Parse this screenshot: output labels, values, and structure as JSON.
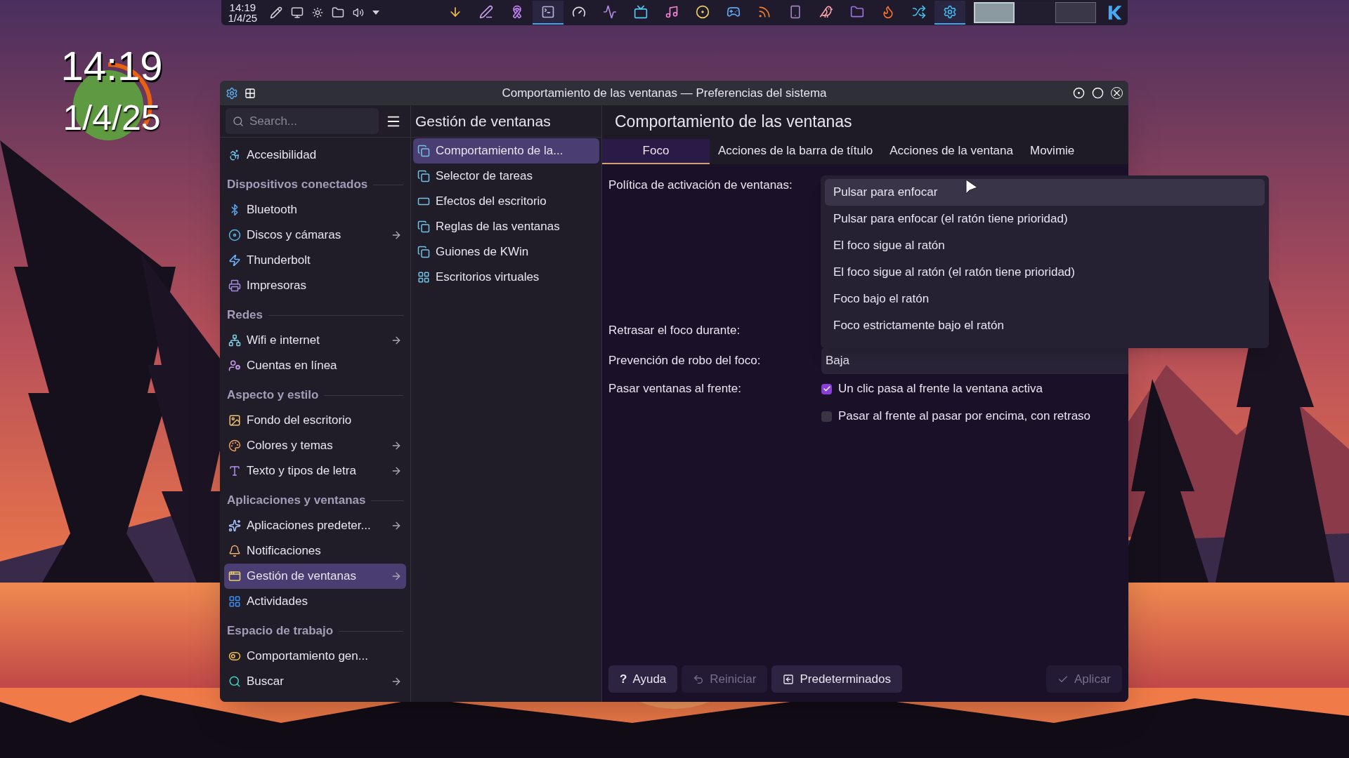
{
  "desktop_clock": {
    "time": "14:19",
    "date": "1/4/25"
  },
  "panel": {
    "clock": {
      "time": "14:19",
      "date": "1/4/25"
    },
    "tasks": [
      {
        "active": false
      },
      {
        "active": false
      },
      {
        "active": false
      },
      {
        "active": true
      },
      {
        "active": false
      },
      {
        "active": false
      },
      {
        "active": false
      },
      {
        "active": false
      },
      {
        "active": false
      },
      {
        "active": false
      },
      {
        "active": false
      },
      {
        "active": false
      },
      {
        "active": false
      },
      {
        "active": false
      },
      {
        "active": false
      },
      {
        "active": false
      },
      {
        "active": true
      }
    ],
    "pager": [
      {
        "selected": true
      },
      {
        "selected": false
      },
      {
        "selected": false
      }
    ]
  },
  "window": {
    "title": "Comportamiento de las ventanas — Preferencias del sistema"
  },
  "sidebar": {
    "search": {
      "placeholder": "Search..."
    },
    "items": [
      {
        "kind": "item",
        "label": "Accesibilidad",
        "arrow": false,
        "selected": false
      },
      {
        "kind": "heading",
        "label": "Dispositivos conectados"
      },
      {
        "kind": "item",
        "label": "Bluetooth",
        "arrow": false,
        "selected": false
      },
      {
        "kind": "item",
        "label": "Discos y cámaras",
        "arrow": true,
        "selected": false
      },
      {
        "kind": "item",
        "label": "Thunderbolt",
        "arrow": false,
        "selected": false
      },
      {
        "kind": "item",
        "label": "Impresoras",
        "arrow": false,
        "selected": false
      },
      {
        "kind": "heading",
        "label": "Redes"
      },
      {
        "kind": "item",
        "label": "Wifi e internet",
        "arrow": true,
        "selected": false
      },
      {
        "kind": "item",
        "label": "Cuentas en línea",
        "arrow": false,
        "selected": false
      },
      {
        "kind": "heading",
        "label": "Aspecto y estilo"
      },
      {
        "kind": "item",
        "label": "Fondo del escritorio",
        "arrow": false,
        "selected": false
      },
      {
        "kind": "item",
        "label": "Colores y temas",
        "arrow": true,
        "selected": false
      },
      {
        "kind": "item",
        "label": "Texto y tipos de letra",
        "arrow": true,
        "selected": false
      },
      {
        "kind": "heading",
        "label": "Aplicaciones y ventanas"
      },
      {
        "kind": "item",
        "label": "Aplicaciones predeter...",
        "arrow": true,
        "selected": false
      },
      {
        "kind": "item",
        "label": "Notificaciones",
        "arrow": false,
        "selected": false
      },
      {
        "kind": "item",
        "label": "Gestión de ventanas",
        "arrow": true,
        "selected": true
      },
      {
        "kind": "item",
        "label": "Actividades",
        "arrow": false,
        "selected": false
      },
      {
        "kind": "heading",
        "label": "Espacio de trabajo"
      },
      {
        "kind": "item",
        "label": "Comportamiento gen...",
        "arrow": false,
        "selected": false
      },
      {
        "kind": "item",
        "label": "Buscar",
        "arrow": true,
        "selected": false
      }
    ]
  },
  "subpages": {
    "title": "Gestión de ventanas",
    "items": [
      {
        "label": "Comportamiento de la...",
        "selected": true
      },
      {
        "label": "Selector de tareas",
        "selected": false
      },
      {
        "label": "Efectos del escritorio",
        "selected": false
      },
      {
        "label": "Reglas de las ventanas",
        "selected": false
      },
      {
        "label": "Guiones de KWin",
        "selected": false
      },
      {
        "label": "Escritorios virtuales",
        "selected": false
      }
    ]
  },
  "content": {
    "title": "Comportamiento de las ventanas",
    "tabs": [
      {
        "label": "Foco",
        "selected": true
      },
      {
        "label": "Acciones de la barra de título",
        "selected": false
      },
      {
        "label": "Acciones de la ventana",
        "selected": false
      },
      {
        "label": "Movimie",
        "selected": false
      }
    ],
    "activation_policy": {
      "label": "Política de activación de ventanas:",
      "options": [
        {
          "label": "Pulsar para enfocar",
          "selected": true
        },
        {
          "label": "Pulsar para enfocar (el ratón tiene prioridad)",
          "selected": false
        },
        {
          "label": "El foco sigue al ratón",
          "selected": false
        },
        {
          "label": "El foco sigue al ratón (el ratón tiene prioridad)",
          "selected": false
        },
        {
          "label": "Foco bajo el ratón",
          "selected": false
        },
        {
          "label": "Foco estrictamente bajo el ratón",
          "selected": false
        }
      ]
    },
    "focus_delay": {
      "label": "Retrasar el foco durante:"
    },
    "focus_stealing": {
      "label": "Prevención de robo del foco:",
      "value": "Baja"
    },
    "raise": {
      "label": "Pasar ventanas al frente:",
      "checkboxes": [
        {
          "label": "Un clic pasa al frente la ventana activa",
          "checked": true
        },
        {
          "label": "Pasar al frente al pasar por encima, con retraso",
          "checked": false
        }
      ]
    },
    "buttons": [
      {
        "kind": "help",
        "glyph": "?",
        "label": "Ayuda",
        "disabled": false
      },
      {
        "kind": "reset",
        "label": "Reiniciar",
        "disabled": true
      },
      {
        "kind": "defaults",
        "label": "Predeterminados",
        "disabled": false
      },
      {
        "kind": "apply",
        "label": "Aplicar",
        "disabled": true
      }
    ]
  }
}
